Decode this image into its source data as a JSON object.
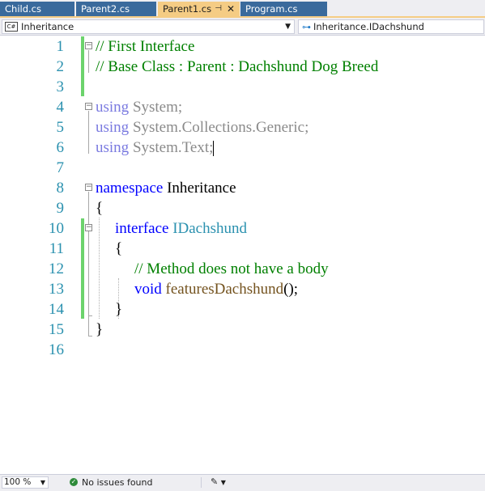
{
  "tabs": [
    {
      "label": "Child.cs",
      "active": false
    },
    {
      "label": "Parent2.cs",
      "active": false
    },
    {
      "label": "Parent1.cs",
      "active": true,
      "pin_icon": "pin-icon",
      "close_icon": "close-icon"
    },
    {
      "label": "Program.cs",
      "active": false
    }
  ],
  "navbar": {
    "project_icon_text": "C#",
    "project": "Inheritance",
    "member": "Inheritance.IDachshund"
  },
  "editor": {
    "line_numbers": [
      "1",
      "2",
      "3",
      "4",
      "5",
      "6",
      "7",
      "8",
      "9",
      "10",
      "11",
      "12",
      "13",
      "14",
      "15",
      "16"
    ],
    "lines": {
      "l1": "// First Interface",
      "l2": "// Base Class : Parent : Dachshund Dog Breed",
      "l4_kw": "using",
      "l4_rest": " System;",
      "l5_kw": "using",
      "l5_rest": " System.Collections.Generic;",
      "l6_kw": "using",
      "l6_rest": " System.Text;",
      "l8_kw": "namespace",
      "l8_rest": " Inheritance",
      "l9": "{",
      "l10_kw": "interface",
      "l10_type": " IDachshund",
      "l11": "{",
      "l12": "// Method does not have a body",
      "l13_kw": "void",
      "l13_fn": "featuresDachshund",
      "l13_rest": "();",
      "l14": "}",
      "l15": "}"
    }
  },
  "statusbar": {
    "zoom": "100 %",
    "issues": "No issues found",
    "issues_icon": "check-circle-icon",
    "cleanup_icon": "brush-icon"
  },
  "colors": {
    "keyword": "#0000ff",
    "comment": "#008000",
    "type": "#2b91af",
    "method": "#74531f",
    "line_number": "#2b91af",
    "active_tab": "#f5cc84",
    "inactive_tab": "#3a6a9c",
    "change_bar": "#6cd36c"
  }
}
